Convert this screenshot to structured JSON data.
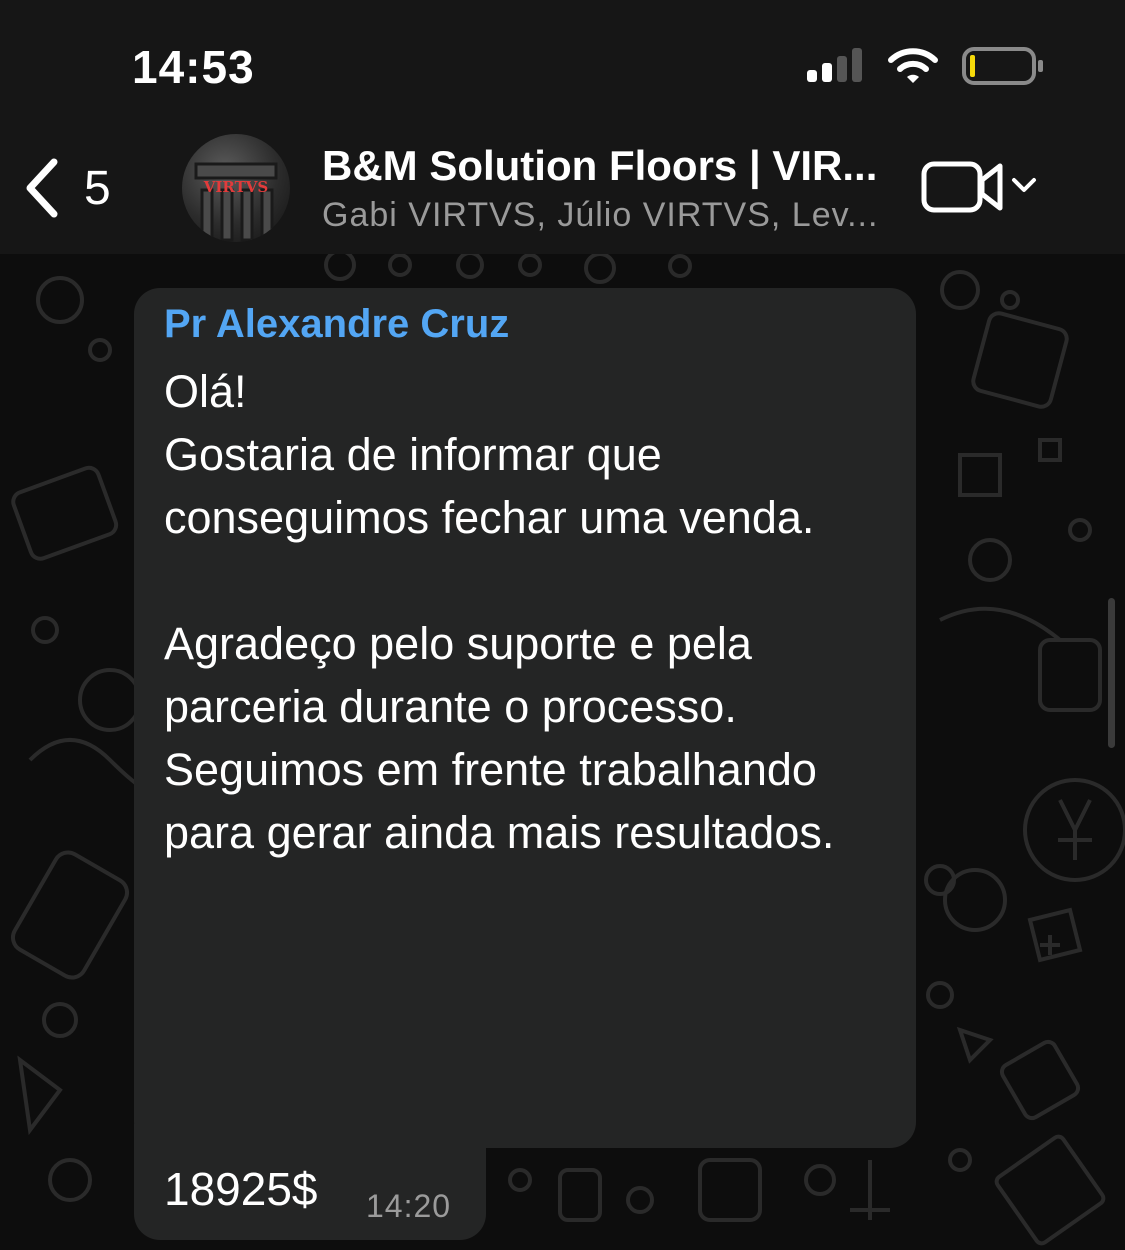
{
  "status_bar": {
    "time": "14:53",
    "icons": [
      "cellular-signal-icon",
      "wifi-icon",
      "battery-icon"
    ],
    "battery_level": 0.06
  },
  "header": {
    "back_count": "5",
    "avatar_text": "VIRTVS",
    "title": "B&M Solution Floors | VIR...",
    "subtitle": "Gabi VIRTVS, Júlio VIRTVS, Lev...",
    "video_icon": "video-camera-icon"
  },
  "message": {
    "sender": "Pr Alexandre Cruz",
    "text": "Olá!\nGostaria de informar que\nconseguimos fechar uma venda.\n\nAgradeço pelo suporte e pela\nparceria durante o processo.\nSeguimos em frente trabalhando\npara gerar ainda mais resultados.",
    "amount": "18925$",
    "time": "14:20"
  },
  "colors": {
    "sender_name": "#53a6f4",
    "bubble": "#242525",
    "header_bg": "#161616",
    "battery_low": "#f5d90a"
  }
}
